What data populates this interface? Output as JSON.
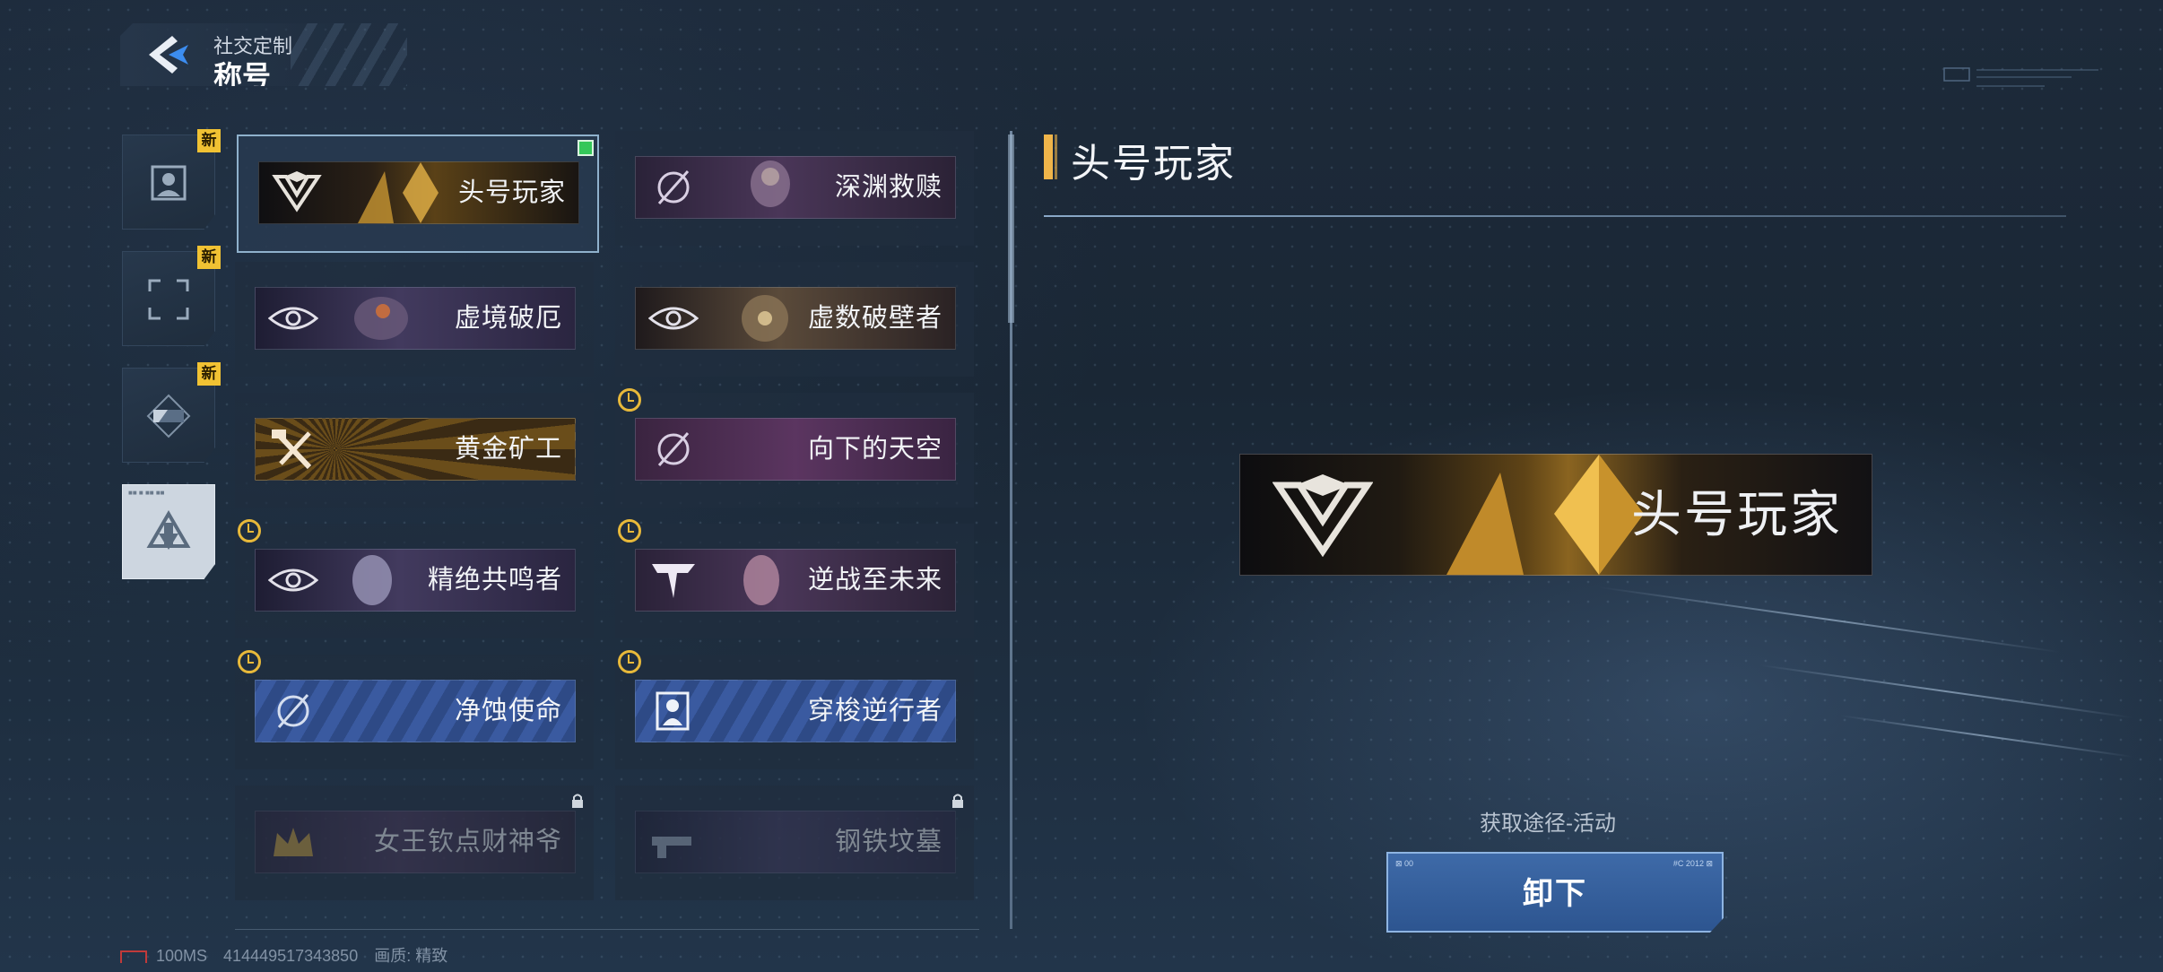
{
  "header": {
    "subtitle": "社交定制",
    "title": "称号"
  },
  "categories": [
    {
      "icon": "portrait-icon",
      "new_badge": "新",
      "active": false
    },
    {
      "icon": "frame-icon",
      "new_badge": "新",
      "active": false
    },
    {
      "icon": "card-icon",
      "new_badge": "新",
      "active": false
    },
    {
      "icon": "title-emblem-icon",
      "new_badge": "",
      "active": true
    }
  ],
  "titles": [
    {
      "label": "头号玩家",
      "style": "gold",
      "emblem": "v-crest-icon",
      "selected": true,
      "timed": false,
      "locked": false
    },
    {
      "label": "深渊救赎",
      "style": "purple",
      "emblem": "slash-circle-icon",
      "selected": false,
      "timed": false,
      "locked": false
    },
    {
      "label": "虚境破厄",
      "style": "violet",
      "emblem": "eye-icon",
      "selected": false,
      "timed": false,
      "locked": false
    },
    {
      "label": "虚数破壁者",
      "style": "brown",
      "emblem": "eye-icon",
      "selected": false,
      "timed": false,
      "locked": false
    },
    {
      "label": "黄金矿工",
      "style": "mine",
      "emblem": "pickaxe-icon",
      "selected": false,
      "timed": false,
      "locked": false
    },
    {
      "label": "向下的天空",
      "style": "plum",
      "emblem": "slash-circle-icon",
      "selected": false,
      "timed": true,
      "locked": false
    },
    {
      "label": "精绝共鸣者",
      "style": "violet",
      "emblem": "eye-icon",
      "selected": false,
      "timed": true,
      "locked": false
    },
    {
      "label": "逆战至未来",
      "style": "purple",
      "emblem": "t-logo-icon",
      "selected": false,
      "timed": true,
      "locked": false
    },
    {
      "label": "净蚀使命",
      "style": "blue",
      "emblem": "slash-circle-icon",
      "selected": false,
      "timed": true,
      "locked": false
    },
    {
      "label": "穿梭逆行者",
      "style": "blue",
      "emblem": "shield-figure-icon",
      "selected": false,
      "timed": true,
      "locked": false
    },
    {
      "label": "女王钦点财神爷",
      "style": "purple",
      "emblem": "crown-icon",
      "selected": false,
      "timed": false,
      "locked": true
    },
    {
      "label": "钢铁坟墓",
      "style": "violet",
      "emblem": "gun-icon",
      "selected": false,
      "timed": false,
      "locked": true
    }
  ],
  "detail": {
    "title": "头号玩家",
    "banner_label": "头号玩家",
    "acquire_text": "获取途径-活动",
    "unequip_label": "卸下"
  },
  "footer": {
    "ping": "100MS",
    "uid": "414449517343850",
    "quality": "画质: 精致"
  },
  "colors": {
    "accent_gold": "#f0b54a",
    "badge_yellow": "#f1c233",
    "button_blue": "#3e6aa8",
    "selected_green": "#34c759"
  }
}
